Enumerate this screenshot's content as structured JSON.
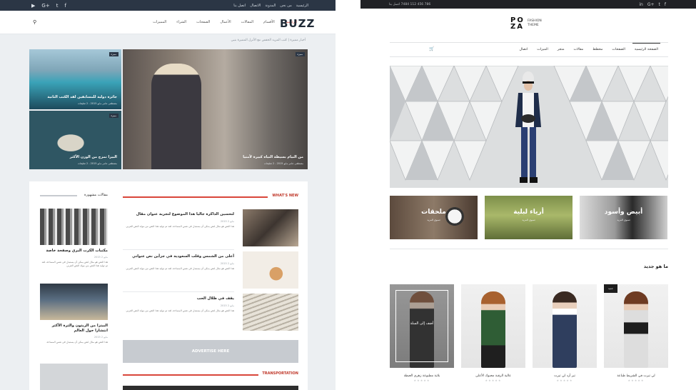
{
  "buzz": {
    "social": [
      "f",
      "t",
      "G+",
      "▶"
    ],
    "top_links": [
      "الرئيسية",
      "من نحن",
      "المدونة",
      "الاتصال",
      "اتصل بنا"
    ],
    "logo": "BUZZ",
    "nav": [
      "الرئيسية",
      "الأقسام",
      "المقالات",
      "الأعمال",
      "الصفحات",
      "الشراء",
      "المميزات"
    ],
    "search_icon": "search-icon",
    "breadcrumb": "أخبار مميزة | كتب المزيد الخفض مع الأنزل المميزة بنيي",
    "tiles": [
      {
        "tag": "مميزة",
        "caption": "جائزة دولية للمسابقين لقد الكتب الثانية",
        "meta": "مصطفى عامر مايو 2015 ، 2 تعليقات"
      },
      {
        "tag": "مميزة",
        "caption": "البيزا تمزج من الوزن الأكثر",
        "meta": "مصطفى عامر مايو 2015 ، 2 تعليقات"
      },
      {
        "tag": "مميزة",
        "caption": "من النيام بسيطة النياه كبيرة لأمنيا",
        "meta": "مصطفى عامر مايو 2015 ، 2 تعليقات"
      }
    ],
    "side_head": "مقالات مشهورة",
    "side_items": [
      {
        "title": "مكتبات الكرت البري وصفحة خاصة",
        "meta": "مايو 2 2015",
        "excerpt": "هذا النص هو مثال لنص يمكن أن يستبدل في نفس المساحة، لقد تم توليد هذا النص من مولد النص العربي"
      },
      {
        "title": "البيتزا من الزيتون والثرة الأكثر انتشارا حول العالم",
        "meta": "مايو 2 2015",
        "excerpt": "هذا النص هو مثال لنص يمكن أن يستبدل في نفس المساحة"
      }
    ],
    "new_head": "WHAT'S NEW",
    "new_items": [
      {
        "title": "لتحسين الذاكرة جاليا هذا الموضوع لتجربة عنوان مقال",
        "meta": "مايو 2 2015",
        "excerpt": "هذا النص هو مثال لنص يمكن أن يستبدل في نفس المساحة، لقد تم توليد هذا النص من مولد النص العربي"
      },
      {
        "title": "أعلى من الشمس وقلب السعودية في جزأين نص عنواني",
        "meta": "مايو 2 2015",
        "excerpt": "هذا النص هو مثال لنص يمكن أن يستبدل في نفس المساحة، لقد تم توليد هذا النص من مولد النص العربي"
      },
      {
        "title": "يقف في ظلال الحب",
        "meta": "مايو 2 2015",
        "excerpt": "هذا النص هو مثال لنص يمكن أن يستبدل في نفس المساحة، لقد تم توليد هذا النص من مولد النص العربي"
      }
    ],
    "advertise": "ADVERTISE HERE",
    "transport_head": "TRANSPORTATION"
  },
  "poza": {
    "phone": "786 456 112 7484 اتصل بنا",
    "social": [
      "in",
      "G+",
      "t",
      "f"
    ],
    "logo_mark": "PO ZA",
    "logo_sub_1": "FASHION",
    "logo_sub_2": "THEME",
    "nav": [
      "الصفحة الرئيسية",
      "الصفحات",
      "مخطط",
      "مقالات",
      "متجر",
      "الميزات",
      "اتصال"
    ],
    "categories": [
      {
        "label": "ملحقات",
        "sub": "تسوق المزيد"
      },
      {
        "label": "أرياء لبلية",
        "sub": "تسوق المزيد"
      },
      {
        "label": "أبيض وأسود",
        "sub": "تسوق المزيد"
      }
    ],
    "whats_new": "ما هو جديد",
    "products": [
      {
        "name": "بلاية مطبوعة زهري العبطة",
        "overlay": "أضف إلى السلة",
        "stars": "★★★★★"
      },
      {
        "name": "عالية الرقبة محبوك الأعلى",
        "overlay": "",
        "stars": "★★★★★"
      },
      {
        "name": "تير أرد لي تيرت",
        "overlay": "",
        "stars": "★★★★★"
      },
      {
        "name": "لي تيرت في الشريط طباعة",
        "overlay": "",
        "tag": "جديد",
        "stars": "★★★★★"
      }
    ]
  }
}
